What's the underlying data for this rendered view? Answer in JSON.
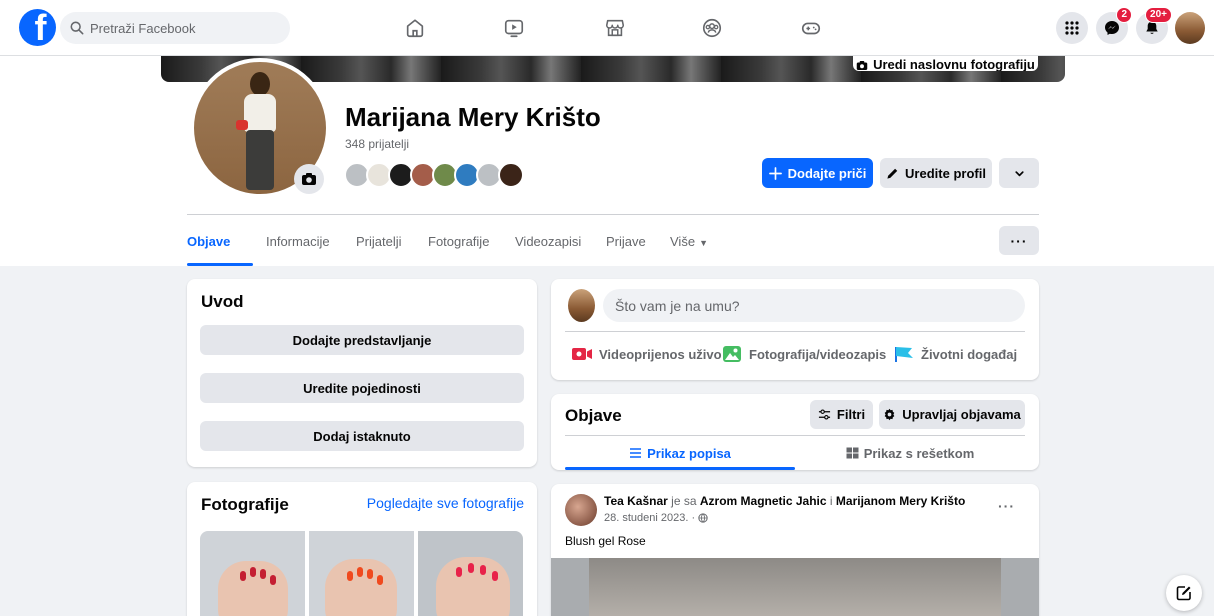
{
  "topbar": {
    "logo_letter": "f",
    "search_placeholder": "Pretraži Facebook",
    "nav_icons": [
      "home-icon",
      "video-icon",
      "marketplace-icon",
      "groups-icon",
      "gaming-icon"
    ],
    "messenger_badge": "2",
    "notifications_badge": "20+"
  },
  "cover": {
    "edit_cover_label": "Uredi naslovnu fotografiju"
  },
  "profile": {
    "name": "Marijana Mery Krišto",
    "friends_count": "348 prijatelji",
    "add_story_label": "Dodajte priči",
    "edit_profile_label": "Uredite profil",
    "more_label": "···"
  },
  "tabs": [
    {
      "label": "Objave",
      "active": true
    },
    {
      "label": "Informacije"
    },
    {
      "label": "Prijatelji"
    },
    {
      "label": "Fotografije"
    },
    {
      "label": "Videozapisi"
    },
    {
      "label": "Prijave"
    },
    {
      "label": "Više"
    }
  ],
  "intro": {
    "title": "Uvod",
    "add_bio_label": "Dodajte predstavljanje",
    "edit_details_label": "Uredite pojedinosti",
    "add_featured_label": "Dodaj istaknuto"
  },
  "photos": {
    "title": "Fotografije",
    "see_all_label": "Pogledajte sve fotografije"
  },
  "composer": {
    "placeholder": "Što vam je na umu?",
    "live_label": "Videoprijenos uživo",
    "photo_label": "Fotografija/videozapis",
    "life_event_label": "Životni događaj"
  },
  "posts_header": {
    "title": "Objave",
    "filters_label": "Filtri",
    "manage_label": "Upravljaj objavama",
    "list_view_label": "Prikaz popisa",
    "grid_view_label": "Prikaz s rešetkom"
  },
  "post": {
    "author": "Tea Kašnar",
    "with_text": "je sa",
    "tagged_1": "Azrom Magnetic Jahic",
    "and_text": "i",
    "tagged_2": "Marijanom Mery Krišto",
    "date": "28. studeni 2023. ·",
    "text": "Blush gel Rose",
    "more_label": "···"
  },
  "colors": {
    "brand_blue": "#0866ff",
    "badge_red": "#e41e3f",
    "page_bg": "#f0f2f5"
  }
}
